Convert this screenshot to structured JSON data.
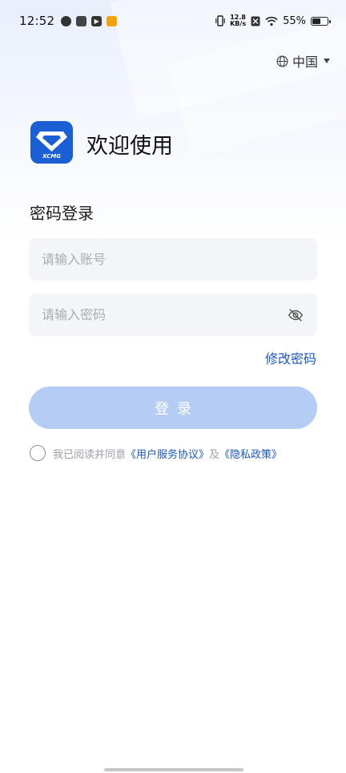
{
  "status_bar": {
    "time": "12:52",
    "left_icons": [
      "app-icon-1",
      "app-icon-2",
      "app-icon-3",
      "app-icon-4"
    ],
    "net_speed_value": "12.8",
    "net_speed_unit": "KB/s",
    "battery": "55%",
    "battery_level": 0.55
  },
  "region": {
    "label": "中国",
    "icon": "globe-icon"
  },
  "header": {
    "logo_text": "XCMG",
    "welcome": "欢迎使用"
  },
  "form": {
    "title": "密码登录",
    "account_placeholder": "请输入账号",
    "password_placeholder": "请输入密码",
    "forgot_label": "修改密码",
    "login_label": "登录"
  },
  "agreement": {
    "prefix": "我已阅读并同意",
    "user_agreement": "《用户服务协议》",
    "conjunction": "及",
    "privacy_policy": "《隐私政策》"
  },
  "colors": {
    "accent": "#1a58c2",
    "button_disabled": "#b5cdf5",
    "input_bg": "#f4f5f8"
  }
}
